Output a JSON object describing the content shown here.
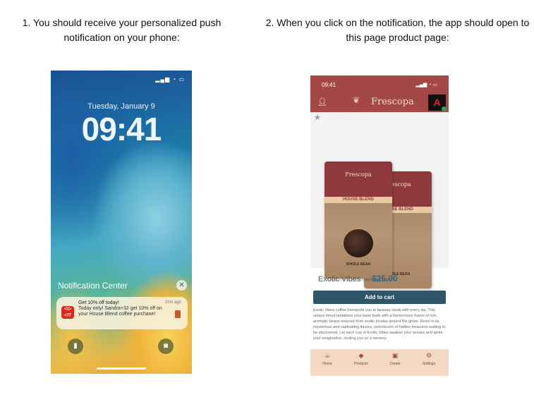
{
  "captions": {
    "step1": "1. You should receive your personalized push notification on your phone:",
    "step2": "2. When you click on the notification, the app should open to this page product page:"
  },
  "lock_screen": {
    "date": "Tuesday, January 9",
    "time": "09:41",
    "notification_center_label": "Notification Center",
    "notification": {
      "title": "Get 10% off today!",
      "time": "10m ago",
      "body": "Today only! Sandra+32 get 10% off on your House Blend coffee purchase!"
    }
  },
  "product_page": {
    "status_time": "09:41",
    "brand": "Frescopa",
    "bag_brand": "Frescopa",
    "bag_blend": "HOUSE BLEND",
    "bag_type": "WHOLE BEAN",
    "product_name": "Exotic Vibes",
    "price": "$25.00",
    "add_to_cart": "Add to cart",
    "description": "Exotic Vibes coffee transports you to faraway lands with every sip. This unique blend tantalizes your taste buds with a harmonious fusion of rich, aromatic beans sourced from exotic locales around the globe. Revel in its mysterious and captivating flavors, reminiscent of hidden treasures waiting to be discovered. Let each cup of Exotic Vibes awaken your senses and ignite your imagination, inviting you on a sensory",
    "tabs": [
      {
        "label": "Home",
        "icon": "coffee-cup-icon"
      },
      {
        "label": "Products",
        "icon": "tag-icon"
      },
      {
        "label": "Create",
        "icon": "image-icon"
      },
      {
        "label": "Settings",
        "icon": "gear-icon"
      }
    ],
    "colors": {
      "header": "#a44846",
      "price": "#2d6a8a",
      "button": "#2f5568",
      "tabbar": "#f3d9c4"
    }
  }
}
